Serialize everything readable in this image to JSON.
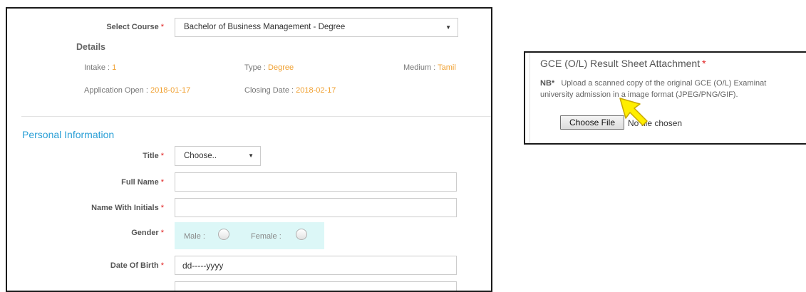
{
  "course": {
    "label": "Select Course",
    "required_mark": "*",
    "value": "Bachelor of Business Management - Degree"
  },
  "details": {
    "heading": "Details",
    "intake_label": "Intake :",
    "intake_value": "1",
    "type_label": "Type :",
    "type_value": "Degree",
    "medium_label": "Medium :",
    "medium_value": "Tamil",
    "open_label": "Application Open :",
    "open_value": "2018-01-17",
    "close_label": "Closing Date :",
    "close_value": "2018-02-17"
  },
  "personal": {
    "section_title": "Personal Information",
    "title_label": "Title",
    "title_value": "Choose..",
    "full_name_label": "Full Name",
    "full_name_value": "",
    "initials_label": "Name With Initials",
    "initials_value": "",
    "gender_label": "Gender",
    "male_label": "Male :",
    "female_label": "Female :",
    "dob_label": "Date Of Birth",
    "dob_value": "dd-----yyyy",
    "required_mark": "*"
  },
  "attachment": {
    "title": "GCE (O/L) Result Sheet Attachment",
    "required_mark": "*",
    "note_prefix": "NB*",
    "note_line1": "Upload a scanned copy of the original GCE (O/L) Examinat",
    "note_line2": "university admission in a image format (JPEG/PNG/GIF).",
    "choose_button": "Choose File",
    "no_file_text": "No file chosen"
  },
  "colors": {
    "accent_blue": "#2a9fd6",
    "value_orange": "#f0a030",
    "required_red": "#e02020",
    "gender_bg": "#dcf7f7",
    "cursor_yellow": "#ffee00"
  },
  "icons": {
    "course_dropdown": "caret-down-icon",
    "title_dropdown": "caret-down-icon",
    "pointer": "arrow-cursor-icon"
  }
}
